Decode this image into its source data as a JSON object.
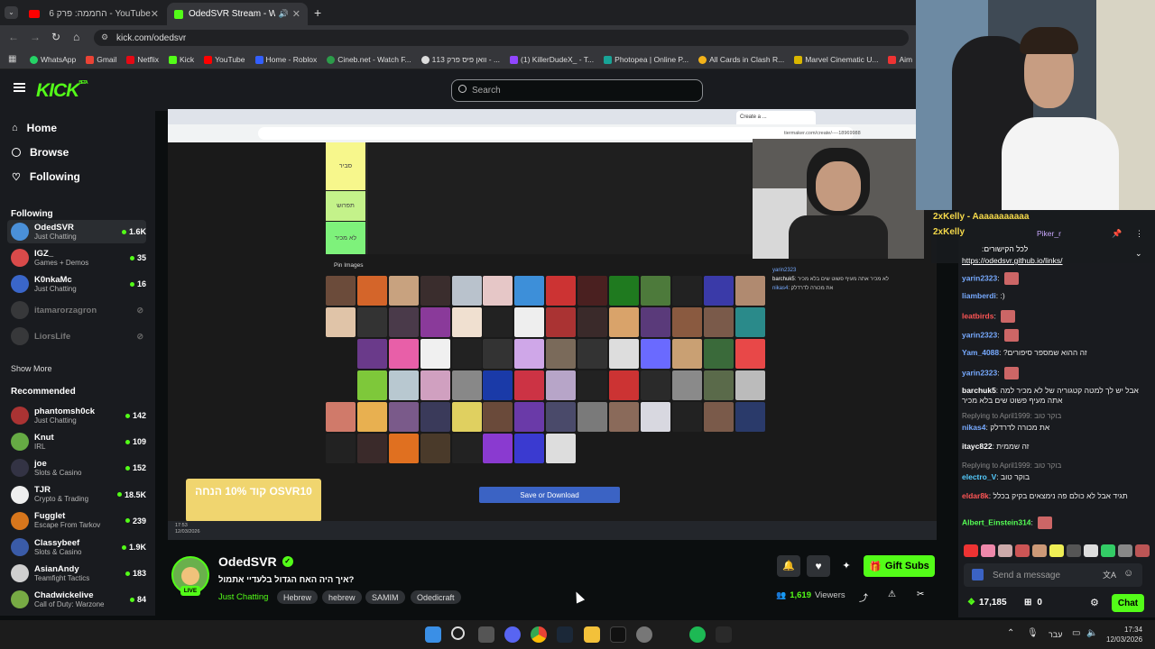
{
  "tabs": [
    {
      "label": "YouTube - החממה: פרק 6",
      "active": false
    },
    {
      "label": "OdedSVR Stream - Watch L",
      "active": true
    }
  ],
  "address": {
    "url": "kick.com/odedsvr"
  },
  "bookmarks": [
    "WhatsApp",
    "Gmail",
    "Netflix",
    "Kick",
    "YouTube",
    "Home - Roblox",
    "Cineb.net - Watch F...",
    "וואן פיס פרק 113 - ...",
    "(1) KillerDudeX_ - T...",
    "Photopea | Online P...",
    "All Cards in Clash R...",
    "Marvel Cinematic U...",
    "Aim"
  ],
  "header": {
    "logo": "KICK",
    "logo_sup": "BETA",
    "search_placeholder": "Search"
  },
  "nav": [
    {
      "label": "Home",
      "icon": "home-icon"
    },
    {
      "label": "Browse",
      "icon": "compass-icon"
    },
    {
      "label": "Following",
      "icon": "heart-icon"
    }
  ],
  "following_title": "Following",
  "following": [
    {
      "name": "OdedSVR",
      "category": "Just Chatting",
      "viewers": "1.6K",
      "live": true,
      "color": "#4a90d9"
    },
    {
      "name": "IGZ_",
      "category": "Games + Demos",
      "viewers": "35",
      "live": true,
      "color": "#d94a4a"
    },
    {
      "name": "K0nkaMc",
      "category": "Just Chatting",
      "viewers": "16",
      "live": true,
      "color": "#3a66c9"
    },
    {
      "name": "itamarorzagron",
      "category": "",
      "viewers": "",
      "live": false,
      "color": "#555"
    },
    {
      "name": "LiorsLife",
      "category": "",
      "viewers": "",
      "live": false,
      "color": "#555"
    }
  ],
  "show_more": "Show More",
  "recommended_title": "Recommended",
  "recommended": [
    {
      "name": "phantomsh0ck",
      "category": "Just Chatting",
      "viewers": "142",
      "color": "#a33"
    },
    {
      "name": "Knut",
      "category": "IRL",
      "viewers": "109",
      "color": "#6a4"
    },
    {
      "name": "joe",
      "category": "Slots & Casino",
      "viewers": "152",
      "color": "#334"
    },
    {
      "name": "TJR",
      "category": "Crypto & Trading",
      "viewers": "18.5K",
      "color": "#eee"
    },
    {
      "name": "Fugglet",
      "category": "Escape From Tarkov",
      "viewers": "239",
      "color": "#d7761c"
    },
    {
      "name": "Classybeef",
      "category": "Slots & Casino",
      "viewers": "1.9K",
      "color": "#3a5ba8"
    },
    {
      "name": "AsianAndy",
      "category": "Teamfight Tactics",
      "viewers": "183",
      "color": "#cfcfcf"
    },
    {
      "name": "Chadwickelive",
      "category": "Call of Duty: Warzone",
      "viewers": "84",
      "color": "#7a4"
    }
  ],
  "stream": {
    "tier_rows": [
      "סביר",
      "תפרוש",
      "לא מכיר"
    ],
    "pin_images": "Pin Images",
    "save_button": "Save or Download",
    "tier_url": "tiermaker.com/create/----18969988",
    "promo_text": "קוד 10% הנחה OSVR10",
    "desktop_time": "17:53",
    "desktop_date": "12/03/2026",
    "overlay_chat": [
      {
        "user": "yarin2323",
        "text": ""
      },
      {
        "user": "barchuk5",
        "text": "לא מכיר אתה מעיף פשוט שים בלא מכיר"
      },
      {
        "user": "nikas4",
        "text": "את מכורה לדרדלק"
      }
    ]
  },
  "streamer": {
    "name": "OdedSVR",
    "title": "?איך היה האח הגדול בלעדיי אתמול",
    "category": "Just Chatting",
    "tags": [
      "Hebrew",
      "hebrew",
      "SAMIM",
      "Odedicraft"
    ],
    "viewers": "1,619",
    "viewers_label": "Viewers",
    "gift_label": "Gift Subs",
    "live": "LIVE"
  },
  "chat": {
    "pinned": {
      "user": "Piker_r",
      "text": "לכל הקישורים:",
      "link": "https://odedsvr.github.io/links/"
    },
    "overlay_top": [
      "2xKelly - Aaaaaaaaaaa",
      "2xKelly"
    ],
    "messages": [
      {
        "user": "yarin2323",
        "text": "",
        "color": "#7af"
      },
      {
        "user": "liamberdi",
        "text": ":)",
        "color": "#7af"
      },
      {
        "user": "leatbirds",
        "text": "",
        "color": "#f55"
      },
      {
        "user": "yarin2323",
        "text": "",
        "color": "#7af"
      },
      {
        "user": "Yam_4088",
        "text": "?זה ההוא שמספר סיפורים",
        "color": "#7af"
      },
      {
        "user": "yarin2323",
        "text": "",
        "color": "#7af"
      },
      {
        "user": "barchuk5",
        "text": "אבל יש לך למטה קטגוריה של לא מכיר למה אתה מעיף פשוט שים בלא מכיר",
        "color": "#fff"
      },
      {
        "reply": "Replying to April1999: בוקר טוב",
        "user": "nikas4",
        "text": "את מכורה לדרדלק",
        "color": "#7af"
      },
      {
        "user": "itayc822",
        "text": "זה שממית",
        "color": "#fff"
      },
      {
        "reply": "Replying to April1999: בוקר טוב",
        "user": "electro_V",
        "text": "בוקר טוב",
        "color": "#5cf"
      },
      {
        "user": "eldar8k",
        "text": "תגיד אבל לא כולם פה נימצאים בקיק בכלל",
        "color": "#f55"
      },
      {
        "user": "Albert_Einstein314",
        "text": "",
        "color": "#5f5"
      }
    ],
    "input_placeholder": "Send a message",
    "points": "17,185",
    "subs": "0",
    "chat_button": "Chat"
  },
  "taskbar": {
    "lang": "עבר",
    "time": "17:34",
    "date": "12/03/2026"
  }
}
